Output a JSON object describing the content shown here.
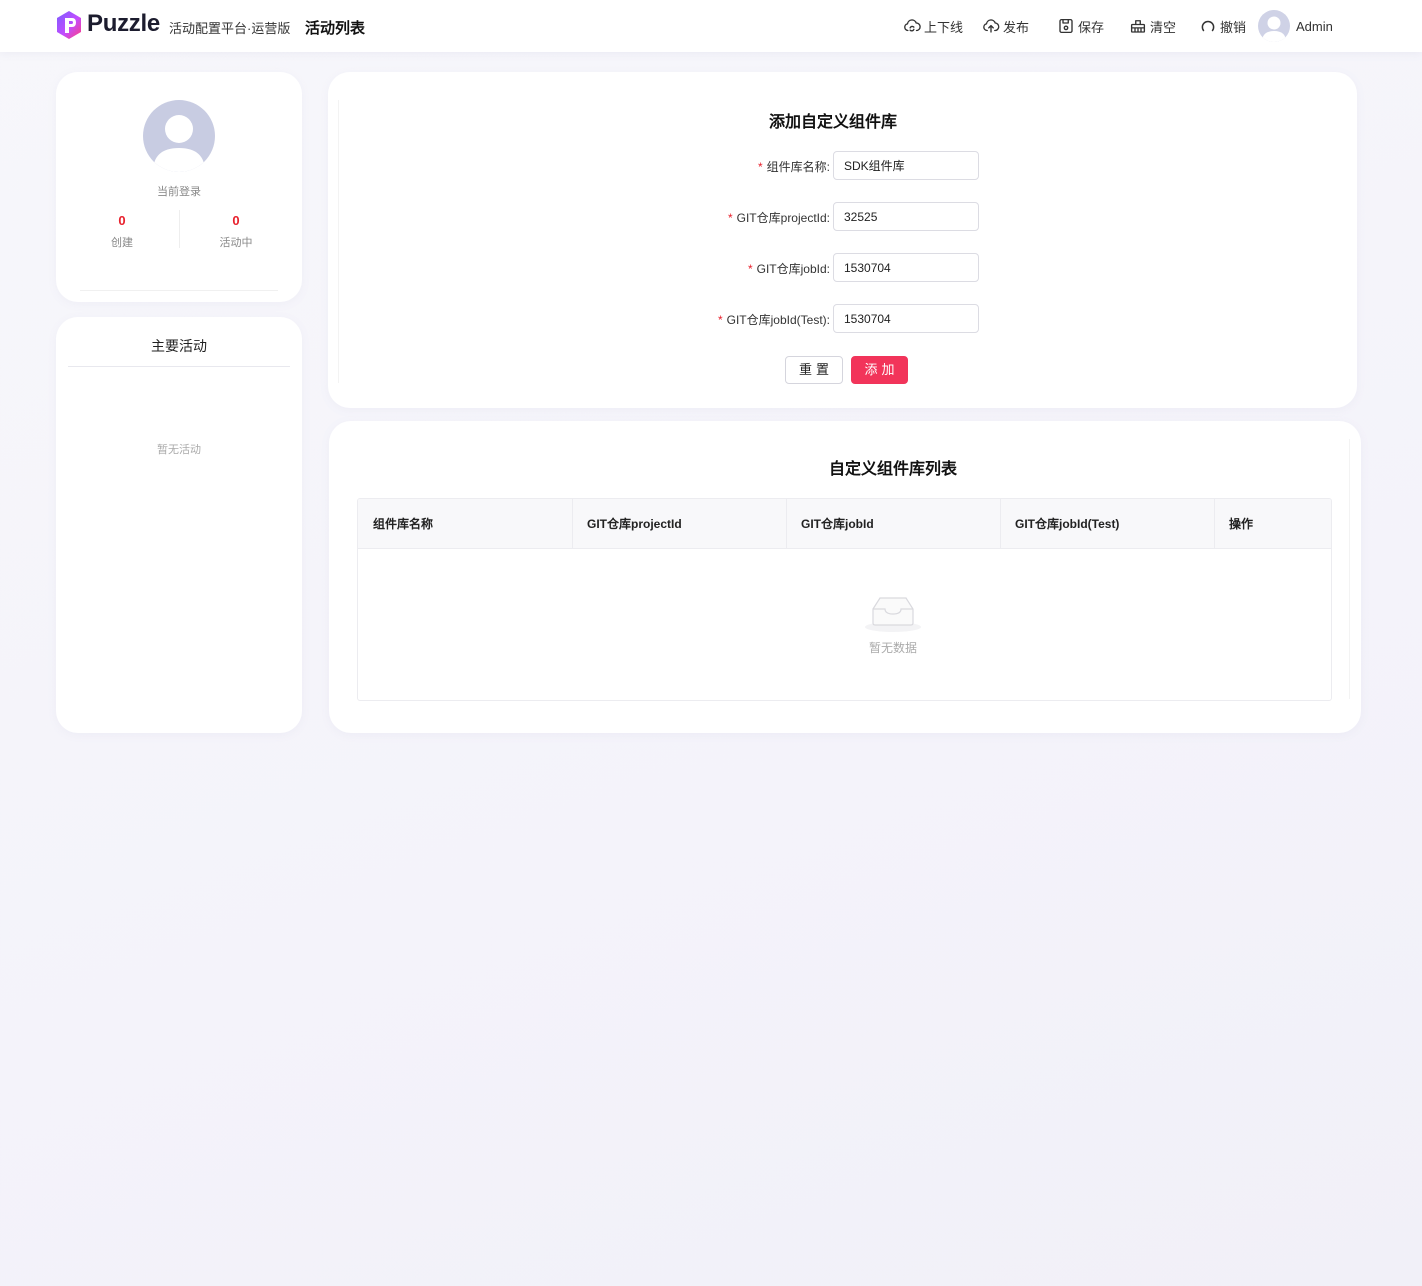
{
  "header": {
    "logo_text": "Puzzle",
    "subtitle": "活动配置平台·运营版",
    "nav_title": "活动列表",
    "tools": {
      "online": "上下线",
      "publish": "发布",
      "save": "保存",
      "clear": "清空",
      "undo": "撤销"
    },
    "user_name": "Admin"
  },
  "profile": {
    "login_label": "当前登录",
    "stats": [
      {
        "value": "0",
        "label": "创建"
      },
      {
        "value": "0",
        "label": "活动中"
      }
    ]
  },
  "activity": {
    "title": "主要活动",
    "empty": "暂无活动"
  },
  "form": {
    "title": "添加自定义组件库",
    "required_mark": "*",
    "fields": [
      {
        "label": "组件库名称:",
        "value": "SDK组件库"
      },
      {
        "label": "GIT仓库projectId:",
        "value": "32525"
      },
      {
        "label": "GIT仓库jobId:",
        "value": "1530704"
      },
      {
        "label": "GIT仓库jobId(Test):",
        "value": "1530704"
      }
    ],
    "reset_label": "重置",
    "add_label": "添加"
  },
  "list": {
    "title": "自定义组件库列表",
    "columns": [
      "组件库名称",
      "GIT仓库projectId",
      "GIT仓库jobId",
      "GIT仓库jobId(Test)",
      "操作"
    ],
    "rows": [],
    "empty": "暂无数据"
  },
  "colors": {
    "accent": "#f2345a",
    "required": "#e8202c",
    "stat_number": "#e8202c"
  }
}
